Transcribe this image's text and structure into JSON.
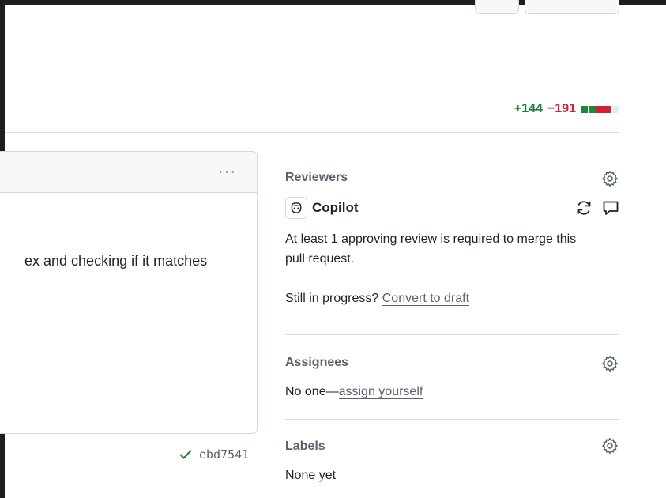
{
  "diffstat": {
    "additions": "+144",
    "deletions": "−191"
  },
  "comment": {
    "menu_glyph": "···",
    "body_text": "ex and checking if it matches"
  },
  "commit": {
    "sha": "ebd7541"
  },
  "sidebar": {
    "reviewers": {
      "title": "Reviewers",
      "reviewer_name": "Copilot",
      "requirement_text_line1": "At least 1 approving review is required to merge this",
      "requirement_text_line2": "pull request.",
      "progress_prefix": "Still in progress?",
      "convert_link": "Convert to draft"
    },
    "assignees": {
      "title": "Assignees",
      "none_prefix": "No one—",
      "assign_link": "assign yourself"
    },
    "labels": {
      "title": "Labels",
      "none_text": "None yet"
    }
  },
  "colors": {
    "additions": "#1a7f37",
    "deletions": "#d1242f",
    "success_check": "#1a7f37",
    "muted": "#59636e"
  },
  "icons": [
    "kebab-horizontal-icon",
    "check-icon",
    "gear-icon",
    "copilot-icon",
    "sync-icon",
    "comment-icon"
  ]
}
